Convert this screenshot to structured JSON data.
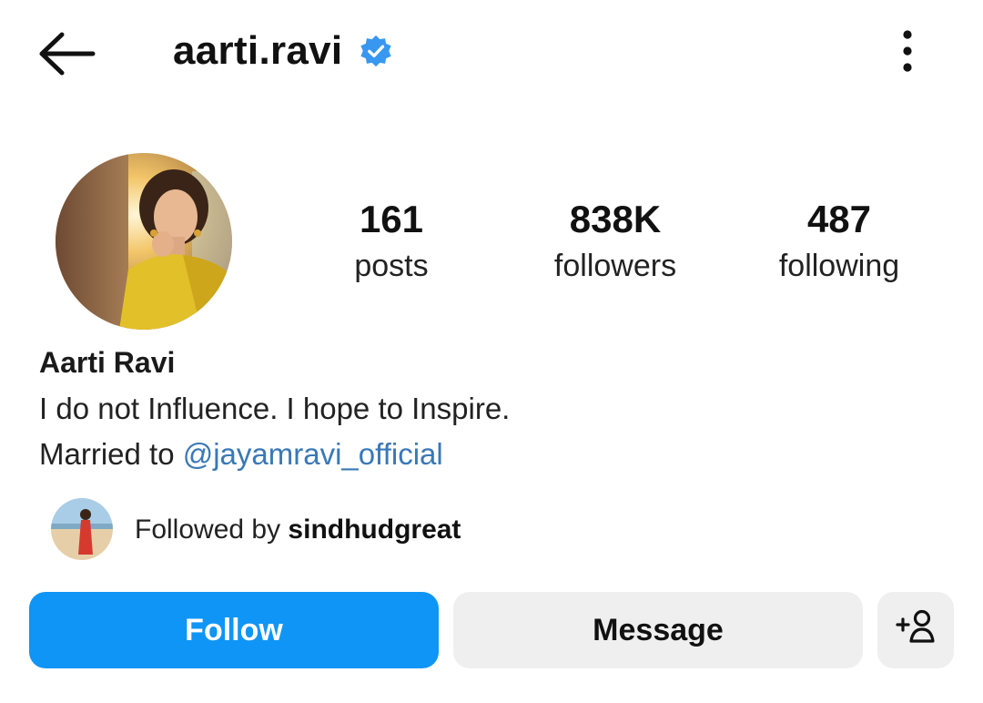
{
  "header": {
    "username": "aarti.ravi",
    "verified": true,
    "accent_color": "#3897f0"
  },
  "profile": {
    "avatar_icon": "profile-photo",
    "stats": [
      {
        "value": "161",
        "label": "posts"
      },
      {
        "value": "838K",
        "label": "followers"
      },
      {
        "value": "487",
        "label": "following"
      }
    ],
    "full_name": "Aarti Ravi",
    "bio_line1": "I do not Influence. I hope to Inspire.",
    "bio_line2_prefix": "Married to ",
    "bio_mention": "@jayamravi_official"
  },
  "followed_by": {
    "prefix": "Followed by ",
    "username": "sindhudgreat"
  },
  "actions": {
    "follow_label": "Follow",
    "message_label": "Message",
    "follow_color": "#0f95f6"
  }
}
